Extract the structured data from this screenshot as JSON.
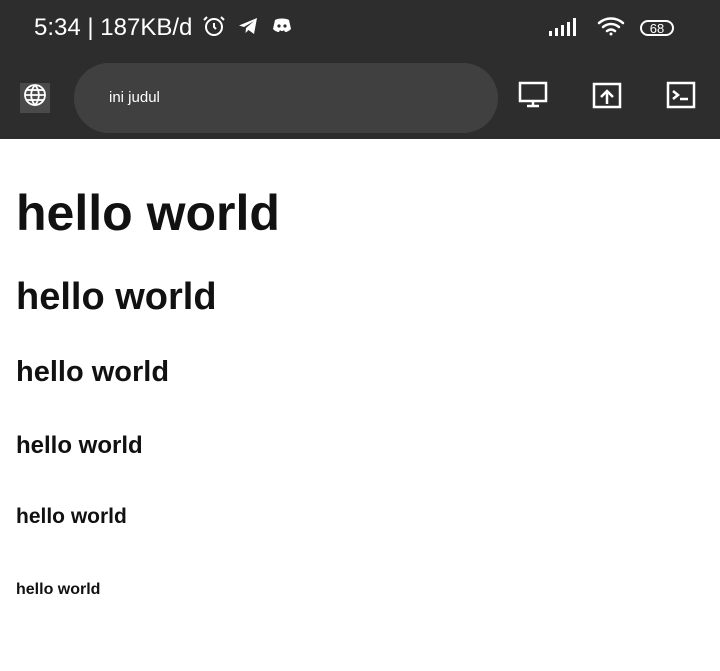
{
  "status_bar": {
    "time": "5:34",
    "network_speed": "187KB/d",
    "battery": "68",
    "icons": [
      "alarm-icon",
      "telegram-icon",
      "discord-icon",
      "signal-icon",
      "wifi-icon",
      "battery-icon"
    ]
  },
  "toolbar": {
    "title": "ini judul",
    "icons": [
      "globe-icon",
      "desktop-icon",
      "open-external-icon",
      "terminal-icon"
    ]
  },
  "content": {
    "headings": [
      "hello world",
      "hello world",
      "hello world",
      "hello world",
      "hello world",
      "hello world"
    ]
  },
  "colors": {
    "chrome_background": "#2d2d2d",
    "address_background": "#404040",
    "page_background": "#ffffff",
    "text": "#111111"
  }
}
